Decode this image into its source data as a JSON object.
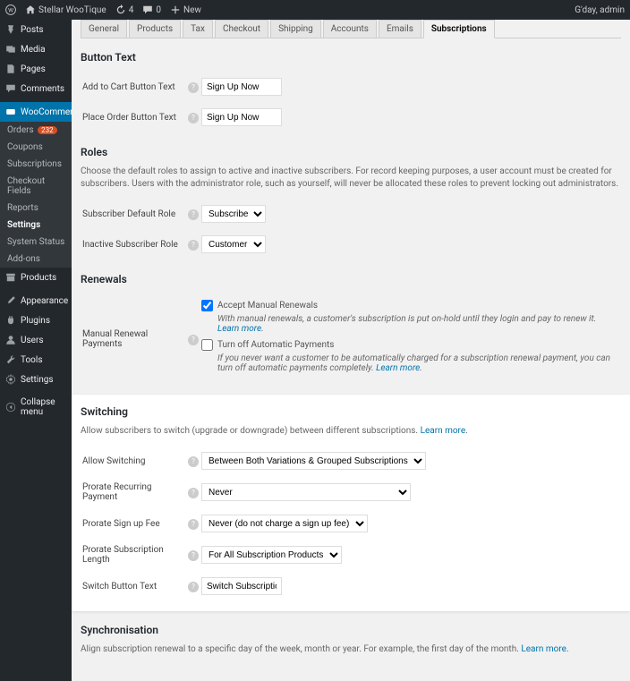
{
  "adminbar": {
    "site": "Stellar WooTique",
    "updates": "4",
    "comments": "0",
    "new": "New",
    "greeting": "G'day, admin"
  },
  "sidebar": {
    "posts": "Posts",
    "media": "Media",
    "pages": "Pages",
    "comments": "Comments",
    "woocommerce": "WooCommerce",
    "wc_sub": {
      "orders": "Orders",
      "orders_badge": "232",
      "coupons": "Coupons",
      "subscriptions": "Subscriptions",
      "checkout_fields": "Checkout Fields",
      "reports": "Reports",
      "settings": "Settings",
      "system_status": "System Status",
      "addons": "Add-ons"
    },
    "products": "Products",
    "appearance": "Appearance",
    "plugins": "Plugins",
    "users": "Users",
    "tools": "Tools",
    "settings": "Settings",
    "collapse": "Collapse menu"
  },
  "tabs": {
    "general": "General",
    "products": "Products",
    "tax": "Tax",
    "checkout": "Checkout",
    "shipping": "Shipping",
    "accounts": "Accounts",
    "emails": "Emails",
    "subscriptions": "Subscriptions"
  },
  "button_text": {
    "heading": "Button Text",
    "add_to_cart_label": "Add to Cart Button Text",
    "add_to_cart_value": "Sign Up Now",
    "place_order_label": "Place Order Button Text",
    "place_order_value": "Sign Up Now"
  },
  "roles": {
    "heading": "Roles",
    "desc": "Choose the default roles to assign to active and inactive subscribers. For record keeping purposes, a user account must be created for subscribers. Users with the administrator role, such as yourself, will never be allocated these roles to prevent locking out administrators.",
    "default_label": "Subscriber Default Role",
    "default_value": "Subscriber",
    "inactive_label": "Inactive Subscriber Role",
    "inactive_value": "Customer"
  },
  "renewals": {
    "heading": "Renewals",
    "manual_label": "Manual Renewal Payments",
    "accept_label": "Accept Manual Renewals",
    "accept_note": "With manual renewals, a customer's subscription is put on-hold until they login and pay to renew it.",
    "turnoff_label": "Turn off Automatic Payments",
    "turnoff_note": "If you never want a customer to be automatically charged for a subscription renewal payment, you can turn off automatic payments completely.",
    "learn_more": "Learn more"
  },
  "switching": {
    "heading": "Switching",
    "desc": "Allow subscribers to switch (upgrade or downgrade) between different subscriptions.",
    "learn_more": "Learn more",
    "allow_label": "Allow Switching",
    "allow_value": "Between Both Variations & Grouped Subscriptions",
    "prorate_recurring_label": "Prorate Recurring Payment",
    "prorate_recurring_value": "Never",
    "prorate_signup_label": "Prorate Sign up Fee",
    "prorate_signup_value": "Never (do not charge a sign up fee)",
    "prorate_length_label": "Prorate Subscription Length",
    "prorate_length_value": "For All Subscription Products",
    "switch_button_label": "Switch Button Text",
    "switch_button_value": "Switch Subscription"
  },
  "sync": {
    "heading": "Synchronisation",
    "desc": "Align subscription renewal to a specific day of the week, month or year. For example, the first day of the month.",
    "learn_more": "Learn more"
  }
}
